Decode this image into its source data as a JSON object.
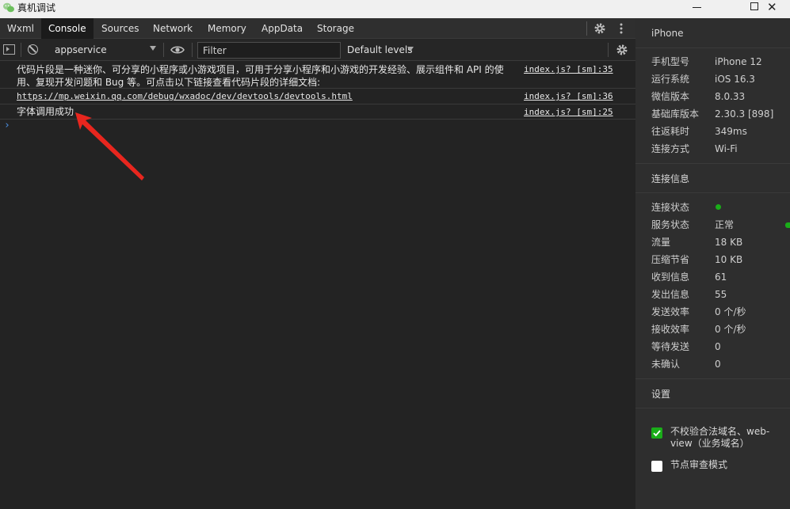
{
  "window": {
    "title": "真机调试"
  },
  "tabs": [
    {
      "label": "Wxml",
      "active": false
    },
    {
      "label": "Console",
      "active": true
    },
    {
      "label": "Sources",
      "active": false
    },
    {
      "label": "Network",
      "active": false
    },
    {
      "label": "Memory",
      "active": false
    },
    {
      "label": "AppData",
      "active": false
    },
    {
      "label": "Storage",
      "active": false
    }
  ],
  "toolbar": {
    "context": "appservice",
    "filter_placeholder": "Filter",
    "levels": "Default levels"
  },
  "console": {
    "messages": [
      {
        "text": "代码片段是一种迷你、可分享的小程序或小游戏项目，可用于分享小程序和小游戏的开发经验、展示组件和 API 的使用、复现开发问题和 Bug 等。可点击以下链接查看代码片段的详细文档:",
        "source": "index.js? [sm]:35"
      },
      {
        "text": "https://mp.weixin.qq.com/debug/wxadoc/dev/devtools/devtools.html",
        "source": "index.js? [sm]:36"
      },
      {
        "text": "字体调用成功",
        "source": "index.js? [sm]:25"
      }
    ],
    "prompt": "›"
  },
  "device": {
    "header": "iPhone",
    "rows": [
      {
        "key": "手机型号",
        "value": "iPhone 12"
      },
      {
        "key": "运行系统",
        "value": "iOS 16.3"
      },
      {
        "key": "微信版本",
        "value": "8.0.33"
      },
      {
        "key": "基础库版本",
        "value": "2.30.3 [898]"
      },
      {
        "key": "往返耗时",
        "value": "349ms"
      },
      {
        "key": "连接方式",
        "value": "Wi-Fi"
      }
    ]
  },
  "connection": {
    "header": "连接信息",
    "status_key": "连接状态",
    "status_color": "#1aad19",
    "rows": [
      {
        "key": "服务状态",
        "value": "正常"
      },
      {
        "key": "流量",
        "value": "18 KB"
      },
      {
        "key": "压缩节省",
        "value": "10 KB"
      },
      {
        "key": "收到信息",
        "value": "61"
      },
      {
        "key": "发出信息",
        "value": "55"
      },
      {
        "key": "发送效率",
        "value": "0 个/秒"
      },
      {
        "key": "接收效率",
        "value": "0 个/秒"
      },
      {
        "key": "等待发送",
        "value": "0"
      },
      {
        "key": "未确认",
        "value": "0"
      }
    ]
  },
  "settings": {
    "header": "设置",
    "options": [
      {
        "label": "不校验合法域名、web-view（业务域名）",
        "checked": true
      },
      {
        "label": "节点审查模式",
        "checked": false
      }
    ]
  },
  "colors": {
    "accent_green": "#1aad19",
    "annotation_arrow": "#e8261e",
    "prompt_blue": "#4a90e2"
  }
}
